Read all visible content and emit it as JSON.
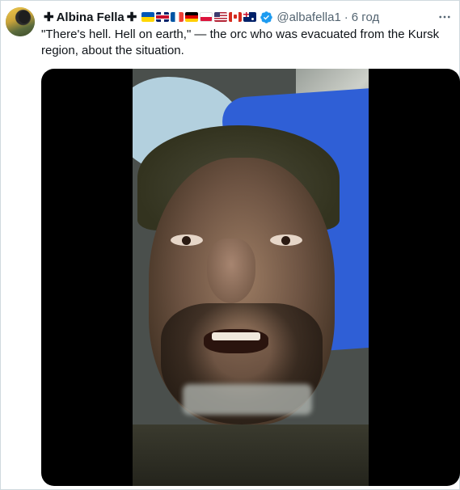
{
  "tweet": {
    "display_name": "Albina Fella",
    "cross_symbol": "✚",
    "flags": [
      "ukraine-flag",
      "uk-flag",
      "france-flag",
      "germany-flag",
      "poland-flag",
      "usa-flag",
      "canada-flag",
      "australia-flag"
    ],
    "handle": "@albafella1",
    "separator": "·",
    "timestamp": "6 год",
    "text": "\"There's hell. Hell on earth,\" — the orc who was evacuated from the Kursk region, about the situation.",
    "more_icon": "more-horizontal-icon",
    "verified_icon": "verified-badge-icon",
    "verified_color": "#1d9bf0"
  },
  "media": {
    "type": "video"
  },
  "colors": {
    "text": "#0f1419",
    "secondary": "#536471",
    "border": "#cfd9de"
  }
}
